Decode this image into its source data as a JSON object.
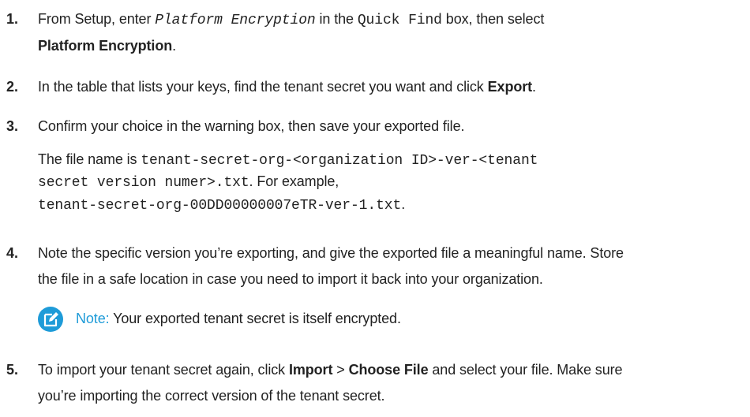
{
  "steps": [
    {
      "number": "1.",
      "line1": {
        "a": "From Setup, enter ",
        "b": "Platform Encryption",
        "c": " in the ",
        "d": "Quick Find",
        "e": " box, then select"
      },
      "line2": {
        "a": "Platform Encryption",
        "b": "."
      }
    },
    {
      "number": "2.",
      "line1": {
        "a": "In the table that lists your keys, find the tenant secret you want and click ",
        "b": "Export",
        "c": "."
      }
    },
    {
      "number": "3.",
      "line1": "Confirm your choice in the warning box, then save your exported file.",
      "detail_line1": {
        "a": "The file name is ",
        "b": "tenant-secret-org-<organization ID>-ver-<tenant"
      },
      "detail_line2": {
        "a": "secret version numer>.txt",
        "b": ". For example,"
      },
      "detail_line3": {
        "a": "tenant-secret-org-00DD00000007eTR-ver-1.txt",
        "b": "."
      }
    },
    {
      "number": "4.",
      "line1": "Note the specific version you’re exporting, and give the exported file a meaningful name. Store",
      "line2": "the file in a safe location in case you need to import it back into your organization.",
      "note": {
        "icon": "edit-note-icon",
        "label": "Note:",
        "text": "  Your exported tenant secret is itself encrypted."
      }
    },
    {
      "number": "5.",
      "line1": {
        "a": "To import your tenant secret again, click ",
        "b": "Import",
        "c": " > ",
        "d": "Choose File",
        "e": " and select your file. Make sure"
      },
      "line2": "you’re importing the correct version of the tenant secret."
    }
  ],
  "colors": {
    "accent": "#1e9bd8",
    "text": "#222222"
  }
}
